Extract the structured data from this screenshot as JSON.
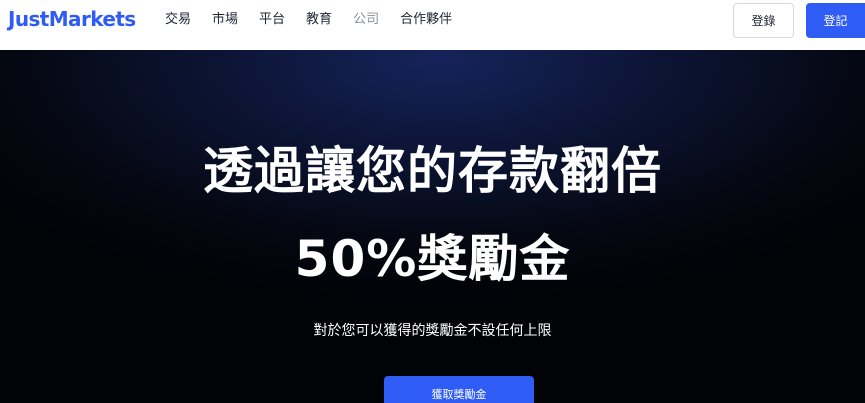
{
  "header": {
    "logo": "JustMarkets",
    "nav": [
      {
        "label": "交易"
      },
      {
        "label": "市場"
      },
      {
        "label": "平台"
      },
      {
        "label": "教育"
      },
      {
        "label": "公司"
      },
      {
        "label": "合作夥伴"
      }
    ],
    "login_label": "登錄",
    "register_label": "登記"
  },
  "hero": {
    "headline_line1": "透過讓您的存款翻倍",
    "headline_line2": "50%獎勵金",
    "subtitle": "對於您可以獲得的獎勵金不設任何上限",
    "cta_label": "獲取獎勵金"
  },
  "colors": {
    "brand": "#2f5cf5",
    "hero_bg": "#050812"
  }
}
